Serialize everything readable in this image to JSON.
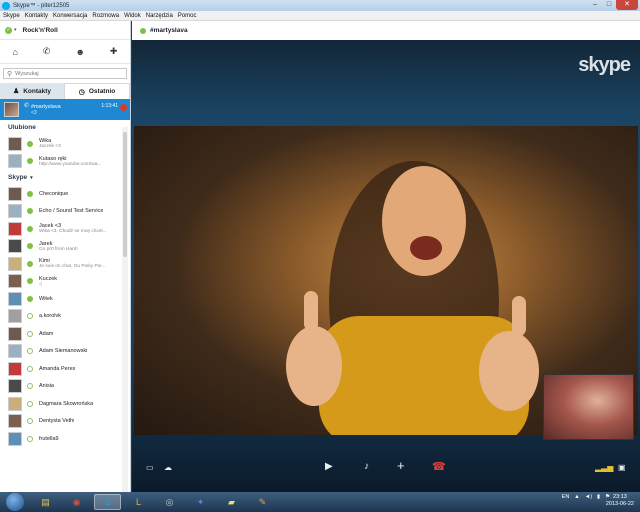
{
  "window": {
    "title": "Skype™ - piter12505"
  },
  "menu": [
    "Skype",
    "Kontakty",
    "Konwersacja",
    "Rozmowa",
    "Widok",
    "Narzędzia",
    "Pomoc"
  ],
  "profile": {
    "mood": "Rock'n'Roll"
  },
  "search": {
    "placeholder": "Wyszukaj"
  },
  "tabs": {
    "contacts": "Kontakty",
    "recent": "Ostatnio"
  },
  "active_call": {
    "name": "#martyslava",
    "status": "<3",
    "timer": "1:13:41"
  },
  "sections": {
    "favorites": "Ulubione",
    "skype": "Skype"
  },
  "favorites": [
    {
      "name": "Wika",
      "status": "Jaczek <3",
      "online": true
    },
    {
      "name": "Kutaso ręki",
      "status": "http://www.youtube.com/wa...",
      "online": true
    }
  ],
  "contacts": [
    {
      "name": "Checonique",
      "status": "",
      "online": true
    },
    {
      "name": "Echo / Sound Test Service",
      "status": "",
      "online": true
    },
    {
      "name": "Jacek <3",
      "status": "Wika <3, Chodź se mnę chcel...",
      "online": true
    },
    {
      "name": "Jarek",
      "status": "Go pr0 from Hard!",
      "online": true
    },
    {
      "name": "Kimi",
      "status": "Je suis on chat, Ou Pinky Pie...",
      "online": true
    },
    {
      "name": "Kuczek",
      "status": ":(",
      "online": true
    },
    {
      "name": "Witek",
      "status": "",
      "online": true
    },
    {
      "name": "a.korolvk",
      "status": "",
      "online": false
    },
    {
      "name": "Adam",
      "status": "",
      "online": false
    },
    {
      "name": "Adam Siemanowski",
      "status": "",
      "online": false
    },
    {
      "name": "Amanda Peres",
      "status": "",
      "online": false
    },
    {
      "name": "Anisia",
      "status": "",
      "online": false
    },
    {
      "name": "Dagmara Skowrońska",
      "status": "",
      "online": false
    },
    {
      "name": "Dentysta Vethi",
      "status": "",
      "online": false
    },
    {
      "name": "frutella9",
      "status": "",
      "online": false
    }
  ],
  "conversation": {
    "title": "#martyslava",
    "logo": "skype"
  },
  "taskbar": {
    "lang": "EN",
    "time": "23:13",
    "date": "2013-06-22"
  }
}
